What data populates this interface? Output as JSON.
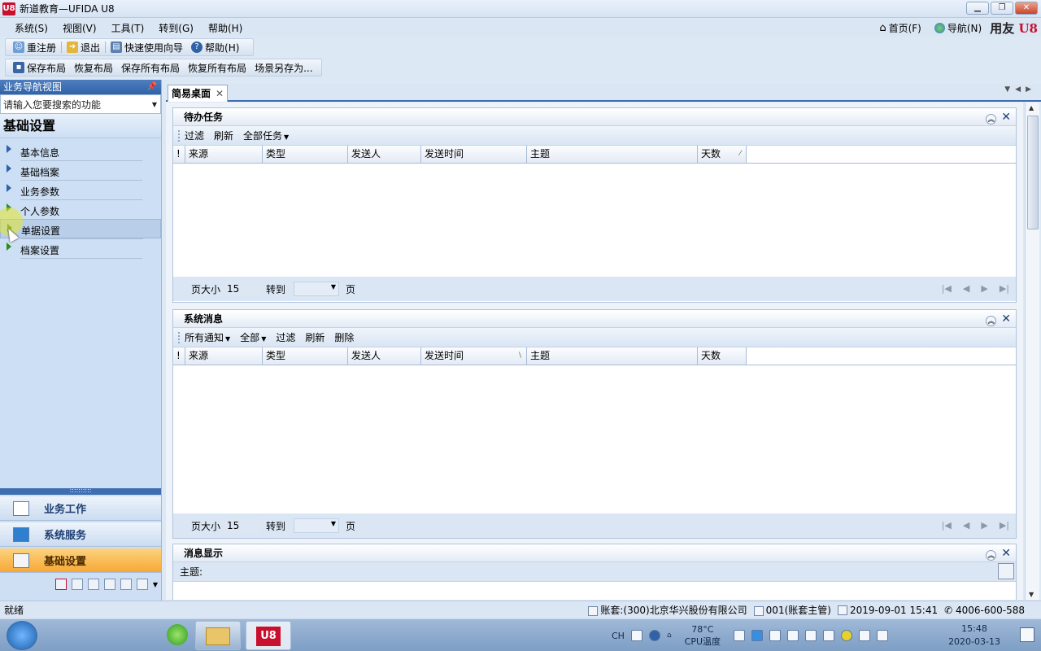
{
  "window": {
    "app_icon": "U8",
    "title": "新道教育—UFIDA U8"
  },
  "menubar": [
    {
      "label": "系统(S)"
    },
    {
      "label": "视图(V)"
    },
    {
      "label": "工具(T)"
    },
    {
      "label": "转到(G)"
    },
    {
      "label": "帮助(H)"
    }
  ],
  "topnav": {
    "home": "首页(F)",
    "nav": "导航(N)",
    "brand": "用友",
    "brand_mark": "U8"
  },
  "toolbar1": {
    "relogin": "重注册",
    "exit": "退出",
    "wizard": "快速使用向导",
    "help": "帮助(H)"
  },
  "toolbar2": {
    "save_layout": "保存布局",
    "restore_layout": "恢复布局",
    "save_all": "保存所有布局",
    "restore_all": "恢复所有布局",
    "save_scene": "场景另存为..."
  },
  "leftnav": {
    "header": "业务导航视图",
    "pin": "ᵖ",
    "search_value": "请输入您要搜索的功能",
    "section_title": "基础设置",
    "items": [
      {
        "label": "基本信息"
      },
      {
        "label": "基础档案"
      },
      {
        "label": "业务参数"
      },
      {
        "label": "个人参数"
      },
      {
        "label": "单据设置"
      },
      {
        "label": "档案设置"
      }
    ],
    "splitter": "::::::::::",
    "bottom": [
      {
        "label": "业务工作"
      },
      {
        "label": "系统服务"
      },
      {
        "label": "基础设置"
      }
    ]
  },
  "tab": {
    "label": "简易桌面",
    "close": "✕"
  },
  "todo": {
    "title": "待办任务",
    "toolbar": {
      "filter": "过滤",
      "refresh": "刷新",
      "all_tasks": "全部任务"
    },
    "columns": [
      "!",
      "来源",
      "类型",
      "发送人",
      "发送时间",
      "主题",
      "天数"
    ],
    "pager": {
      "page_size_label": "页大小",
      "page_size": "15",
      "goto_label": "转到",
      "page_label": "页"
    }
  },
  "sysmsg": {
    "title": "系统消息",
    "toolbar": {
      "all_notices": "所有通知",
      "all": "全部",
      "filter": "过滤",
      "refresh": "刷新",
      "delete": "删除"
    },
    "columns": [
      "!",
      "来源",
      "类型",
      "发送人",
      "发送时间",
      "主题",
      "天数"
    ],
    "pager": {
      "page_size_label": "页大小",
      "page_size": "15",
      "goto_label": "转到",
      "page_label": "页"
    }
  },
  "msgshow": {
    "title": "消息显示",
    "subject_label": "主题:"
  },
  "statusbar": {
    "ready": "就绪",
    "account": "账套:(300)北京华兴股份有限公司",
    "operator": "001(账套主管)",
    "datetime": "2019-09-01 15:41",
    "phone": "4006-600-588"
  },
  "taskbar": {
    "lang": "CH",
    "temp_value": "78°C",
    "temp_label": "CPU温度",
    "time": "15:48",
    "date": "2020-03-13"
  },
  "colors": {
    "accent": "#2f62a8",
    "active_nav": "#f7a736",
    "brand_red": "#c8102e"
  }
}
